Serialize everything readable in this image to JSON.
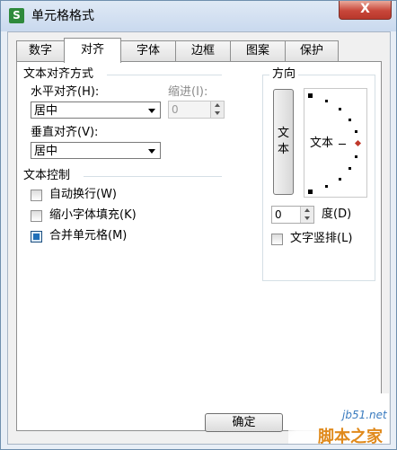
{
  "window": {
    "title": "单元格格式",
    "app_icon": "S",
    "close_label": "X"
  },
  "tabs": [
    {
      "label": "数字"
    },
    {
      "label": "对齐"
    },
    {
      "label": "字体"
    },
    {
      "label": "边框"
    },
    {
      "label": "图案"
    },
    {
      "label": "保护"
    }
  ],
  "active_tab": 1,
  "alignment": {
    "section_title": "文本对齐方式",
    "horizontal_label": "水平对齐(H):",
    "horizontal_value": "居中",
    "indent_label": "缩进(I):",
    "indent_value": "0",
    "vertical_label": "垂直对齐(V):",
    "vertical_value": "居中"
  },
  "control": {
    "section_title": "文本控制",
    "wrap_label": "自动换行(W)",
    "wrap_checked": false,
    "shrink_label": "缩小字体填充(K)",
    "shrink_checked": false,
    "merge_label": "合并单元格(M)",
    "merge_checked": true
  },
  "orientation": {
    "title": "方向",
    "vertical_text": [
      "文",
      "本"
    ],
    "dial_text": "文本",
    "degree_value": "0",
    "degree_label": "度(D)",
    "stacked_label": "文字竖排(L)",
    "stacked_checked": false
  },
  "footer": {
    "ok_label": "确定"
  },
  "watermark": {
    "line1": "jb51.net",
    "line2": "脚本之家"
  }
}
